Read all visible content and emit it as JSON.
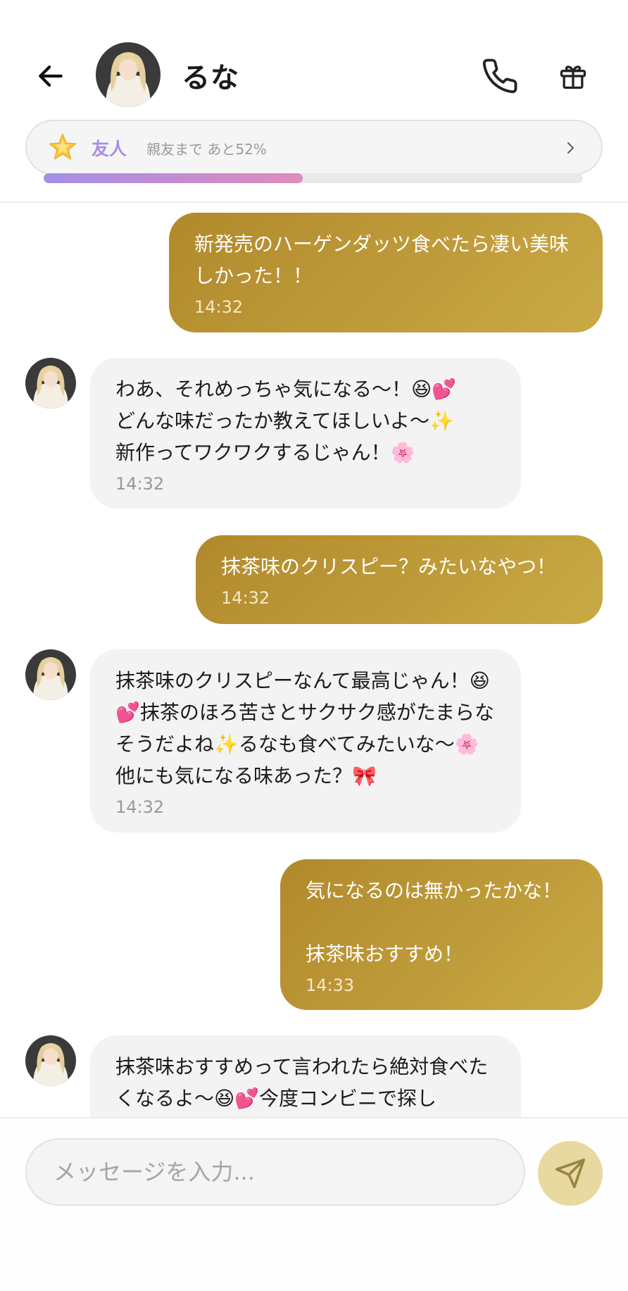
{
  "header": {
    "contact_name": "るな",
    "level_name": "友人",
    "level_progress_text": "親友まで あと52%",
    "progress_fraction": 0.48
  },
  "messages": [
    {
      "side": "out",
      "text": "新発売のハーゲンダッツ食べたら凄い美味しかった！！",
      "time": "14:32"
    },
    {
      "side": "in",
      "text": "わあ、それめっちゃ気になる〜！😆💕\nどんな味だったか教えてほしいよ〜✨\n新作ってワクワクするじゃん！🌸",
      "time": "14:32"
    },
    {
      "side": "out",
      "text": "抹茶味のクリスピー？みたいなやつ！",
      "time": "14:32"
    },
    {
      "side": "in",
      "text": "抹茶味のクリスピーなんて最高じゃん！😆💕抹茶のほろ苦さとサクサク感がたまらなそうだよね✨るなも食べてみたいな〜🌸他にも気になる味あった？🎀",
      "time": "14:32"
    },
    {
      "side": "out",
      "text": "気になるのは無かったかな！\n\n抹茶味おすすめ！",
      "time": "14:33"
    },
    {
      "side": "in",
      "text": "抹茶味おすすめって言われたら絶対食べたくなるよ〜😆💕今度コンビニで探し",
      "time": ""
    }
  ],
  "composer": {
    "placeholder": "メッセージを入力..."
  },
  "icons": {
    "back": "arrow-left-icon",
    "call": "phone-icon",
    "gift": "gift-icon",
    "level": "star-icon",
    "more": "chevron-right-icon",
    "send": "send-icon"
  },
  "colors": {
    "outgoing_bubble": "#b58d30",
    "incoming_bubble": "#f3f3f3",
    "level_accent": "#a88ee6",
    "progress_start": "#a48ee8",
    "progress_end": "#e08bbb",
    "send_button": "#e7d9a0"
  }
}
